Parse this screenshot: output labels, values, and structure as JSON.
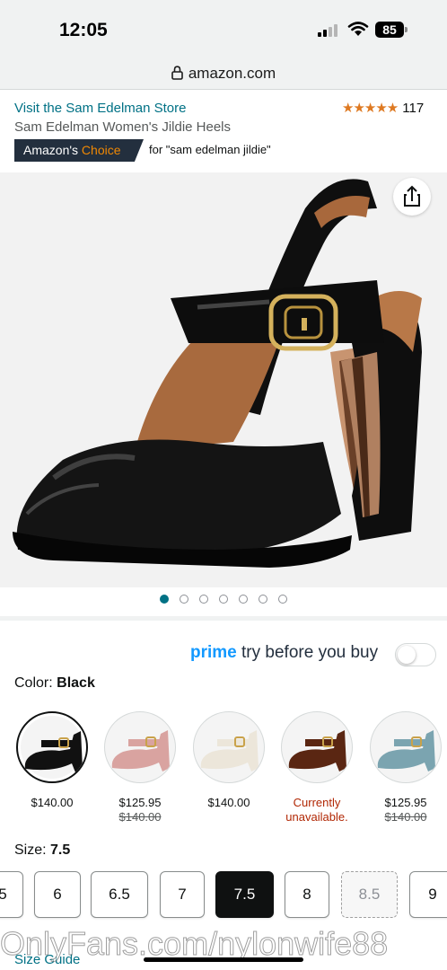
{
  "status_bar": {
    "time": "12:05",
    "battery": "85"
  },
  "browser": {
    "url": "amazon.com"
  },
  "product": {
    "store_link": "Visit the Sam Edelman Store",
    "rating_count": "117",
    "stars": "★★★★★",
    "title": "Sam Edelman Women's Jildie Heels",
    "badge_prefix": "Amazon's",
    "badge_choice": "Choice",
    "badge_for": "for \"sam edelman jildie\""
  },
  "gallery": {
    "image_count": 7,
    "active_index": 0
  },
  "prime": {
    "word": "prime",
    "tagline": "try before you buy",
    "enabled": false
  },
  "color": {
    "label": "Color:",
    "selected": "Black",
    "options": [
      {
        "name": "black",
        "price": "$140.00",
        "list_price": "",
        "color": "#111111"
      },
      {
        "name": "pink",
        "price": "$125.95",
        "list_price": "$140.00",
        "color": "#d9a3a0"
      },
      {
        "name": "ivory",
        "price": "$140.00",
        "list_price": "",
        "color": "#ece6da"
      },
      {
        "name": "brown",
        "price": "Currently unavailable.",
        "list_price": "",
        "color": "#5a2612"
      },
      {
        "name": "blue",
        "price": "$125.95",
        "list_price": "$140.00",
        "color": "#7ba4b0"
      }
    ]
  },
  "size": {
    "label": "Size:",
    "selected": "7.5",
    "options": [
      "5",
      "6",
      "6.5",
      "7",
      "7.5",
      "8",
      "8.5",
      "9"
    ],
    "unavailable": [
      "8.5"
    ],
    "guide": "Size Guide"
  },
  "watermark": "OnlyFans.com/nylonwife88"
}
